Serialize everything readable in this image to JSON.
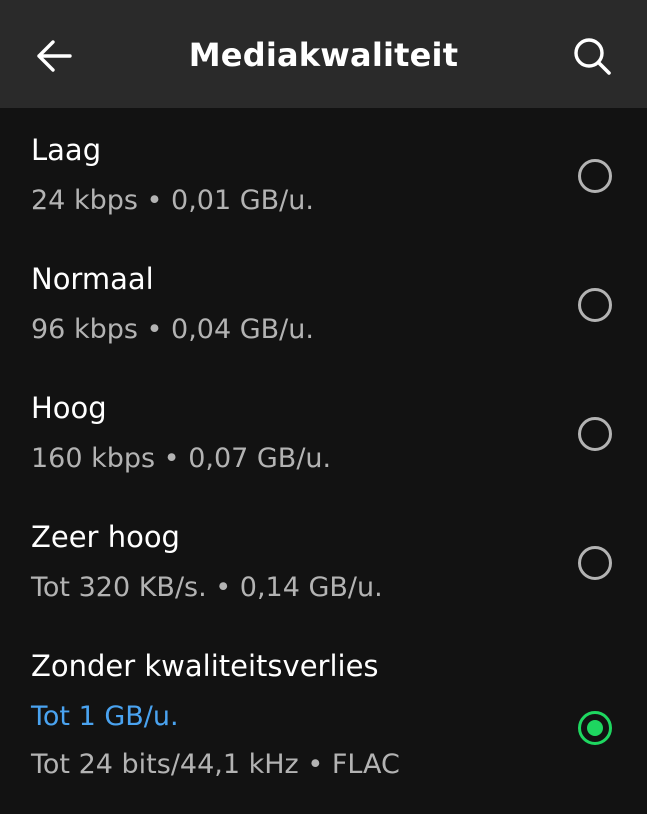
{
  "header": {
    "title": "Mediakwaliteit",
    "back_icon": "arrow-left-icon",
    "search_icon": "search-icon"
  },
  "options": [
    {
      "title": "Laag",
      "subtitle": "24 kbps • 0,01 GB/u.",
      "selected": false
    },
    {
      "title": "Normaal",
      "subtitle": "96 kbps • 0,04 GB/u.",
      "selected": false
    },
    {
      "title": "Hoog",
      "subtitle": "160 kbps • 0,07 GB/u.",
      "selected": false
    },
    {
      "title": "Zeer hoog",
      "subtitle": "Tot 320 KB/s. • 0,14 GB/u.",
      "selected": false
    },
    {
      "title": "Zonder kwaliteitsverlies",
      "accent": "Tot 1 GB/u.",
      "subtitle": "Tot 24 bits/44,1 kHz • FLAC",
      "selected": true
    }
  ],
  "colors": {
    "background": "#121212",
    "header_background": "#2a2a2a",
    "secondary_text": "#b3b3b3",
    "accent_blue": "#4aa3f0",
    "selected_green": "#1ed760"
  }
}
